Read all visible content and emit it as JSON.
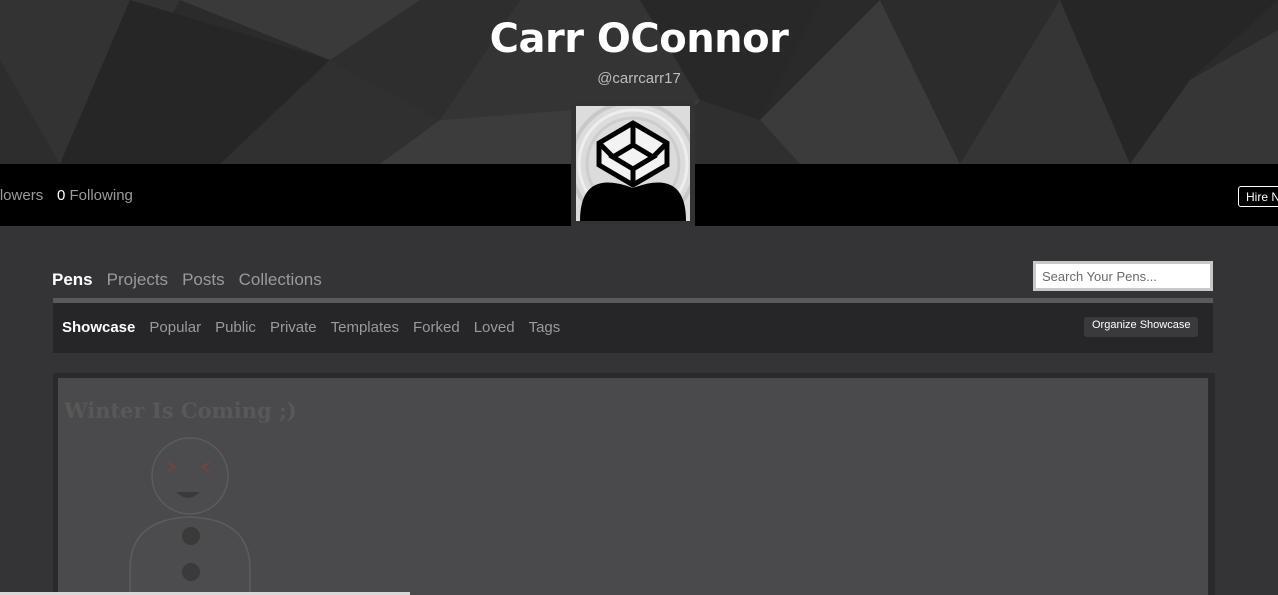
{
  "profile": {
    "name": "Carr OConnor",
    "handle": "@carrcarr17",
    "followers_label": "lowers",
    "following_count": "0",
    "following_label": "Following",
    "hire_label": "Hire N"
  },
  "tabs": [
    {
      "label": "Pens",
      "active": true
    },
    {
      "label": "Projects",
      "active": false
    },
    {
      "label": "Posts",
      "active": false
    },
    {
      "label": "Collections",
      "active": false
    }
  ],
  "search": {
    "placeholder": "Search Your Pens..."
  },
  "subtabs": [
    {
      "label": "Showcase",
      "active": true
    },
    {
      "label": "Popular",
      "active": false
    },
    {
      "label": "Public",
      "active": false
    },
    {
      "label": "Private",
      "active": false
    },
    {
      "label": "Templates",
      "active": false
    },
    {
      "label": "Forked",
      "active": false
    },
    {
      "label": "Loved",
      "active": false
    },
    {
      "label": "Tags",
      "active": false
    }
  ],
  "organize_label": "Organize Showcase",
  "showcase": {
    "title": "Winter Is Coming ;)"
  },
  "icons": {
    "avatar": "codepen-cube-icon",
    "preview": "snowman-icon"
  }
}
